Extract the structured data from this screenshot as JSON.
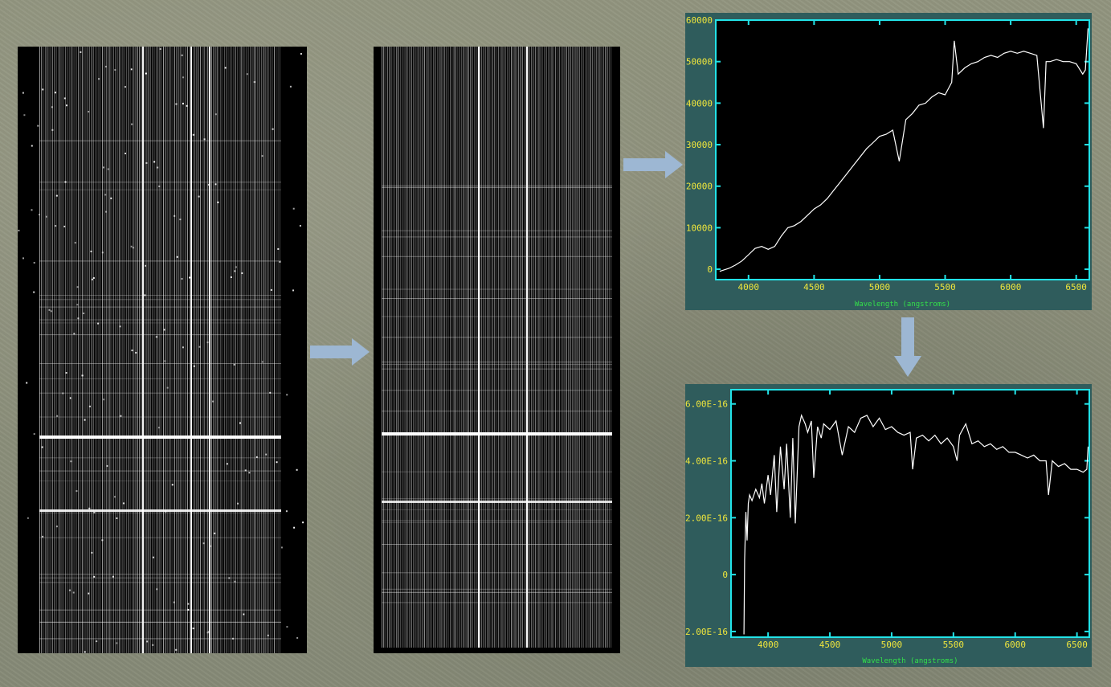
{
  "colors": {
    "background": "#8c8f7e",
    "arrow": "#9db7d3",
    "plot_panel": "#2f5c5c",
    "plot_frame": "#22e3e8",
    "tick_label": "#f0e63c",
    "axis_title": "#33e04a",
    "trace": "#ffffff"
  },
  "images": {
    "raw_frame": {
      "kind": "raw 2D spectral frame with cosmic-ray hits"
    },
    "reduced_frame": {
      "kind": "cleaned 2D spectral frame"
    }
  },
  "arrows": [
    "arrow-right",
    "arrow-right",
    "arrow-down"
  ],
  "chart_data": [
    {
      "type": "line",
      "title": "",
      "xlabel": "Wavelength (angstroms)",
      "ylabel": "",
      "xlim": [
        3750,
        6600
      ],
      "ylim": [
        -2500,
        60000
      ],
      "xticks": [
        4000,
        4500,
        5000,
        5500,
        6000,
        6500
      ],
      "xtick_labels": [
        "4000",
        "4500",
        "5000",
        "5500",
        "6000",
        "6500"
      ],
      "yticks": [
        0,
        10000,
        20000,
        30000,
        40000,
        50000,
        60000
      ],
      "ytick_labels": [
        "0",
        "10000",
        "20000",
        "30000",
        "40000",
        "50000",
        "60000"
      ],
      "series": [
        {
          "x": [
            3780,
            3850,
            3900,
            3950,
            4000,
            4050,
            4100,
            4150,
            4200,
            4250,
            4300,
            4350,
            4400,
            4450,
            4500,
            4550,
            4600,
            4650,
            4700,
            4750,
            4800,
            4850,
            4900,
            4950,
            5000,
            5050,
            5100,
            5150,
            5200,
            5250,
            5300,
            5350,
            5400,
            5450,
            5500,
            5550,
            5570,
            5600,
            5650,
            5700,
            5750,
            5800,
            5850,
            5900,
            5950,
            6000,
            6050,
            6100,
            6150,
            6200,
            6250,
            6270,
            6300,
            6350,
            6400,
            6450,
            6500,
            6550,
            6570,
            6590
          ],
          "y": [
            -500,
            200,
            1000,
            2000,
            3500,
            5000,
            5500,
            4800,
            5500,
            8000,
            10000,
            10500,
            11500,
            13000,
            14500,
            15500,
            17000,
            19000,
            21000,
            23000,
            25000,
            27000,
            29000,
            30500,
            32000,
            32500,
            33500,
            26000,
            36000,
            37500,
            39500,
            40000,
            41500,
            42500,
            42000,
            45000,
            55000,
            47000,
            48500,
            49500,
            50000,
            51000,
            51500,
            51000,
            52000,
            52500,
            52000,
            52500,
            52000,
            51500,
            34000,
            50000,
            50000,
            50500,
            50000,
            50000,
            49500,
            47000,
            48000,
            58000
          ]
        }
      ]
    },
    {
      "type": "line",
      "title": "",
      "xlabel": "Wavelength (angstroms)",
      "ylabel": "",
      "xlim": [
        3700,
        6600
      ],
      "ylim": [
        -2.2e-16,
        6.5e-16
      ],
      "xticks": [
        4000,
        4500,
        5000,
        5500,
        6000,
        6500
      ],
      "xtick_labels": [
        "4000",
        "4500",
        "5000",
        "5500",
        "6000",
        "6500"
      ],
      "yticks": [
        -2e-16,
        0,
        2e-16,
        4e-16,
        6e-16
      ],
      "ytick_labels": [
        "-2.00E-16",
        "0",
        "2.00E-16",
        "4.00E-16",
        "6.00E-16"
      ],
      "series": [
        {
          "x": [
            3805,
            3810,
            3820,
            3830,
            3840,
            3850,
            3870,
            3900,
            3930,
            3950,
            3970,
            4000,
            4020,
            4050,
            4070,
            4100,
            4130,
            4150,
            4180,
            4200,
            4220,
            4250,
            4270,
            4300,
            4320,
            4350,
            4370,
            4400,
            4430,
            4450,
            4500,
            4550,
            4600,
            4650,
            4700,
            4750,
            4800,
            4850,
            4900,
            4950,
            5000,
            5050,
            5100,
            5150,
            5170,
            5200,
            5250,
            5300,
            5350,
            5400,
            5450,
            5500,
            5530,
            5550,
            5600,
            5650,
            5700,
            5750,
            5800,
            5850,
            5900,
            5950,
            6000,
            6050,
            6100,
            6150,
            6200,
            6250,
            6270,
            6300,
            6350,
            6400,
            6450,
            6500,
            6550,
            6580,
            6590
          ],
          "y": [
            -2.1e-16,
            5e-17,
            2.2e-16,
            1.2e-16,
            2.5e-16,
            2.8e-16,
            2.6e-16,
            3e-16,
            2.7e-16,
            3.2e-16,
            2.5e-16,
            3.5e-16,
            2.8e-16,
            4.2e-16,
            2.2e-16,
            4.5e-16,
            3e-16,
            4.6e-16,
            2e-16,
            4.8e-16,
            1.8e-16,
            5.2e-16,
            5.6e-16,
            5.3e-16,
            5e-16,
            5.4e-16,
            3.4e-16,
            5.2e-16,
            4.8e-16,
            5.3e-16,
            5.1e-16,
            5.4e-16,
            4.2e-16,
            5.2e-16,
            5e-16,
            5.5e-16,
            5.6e-16,
            5.2e-16,
            5.5e-16,
            5.1e-16,
            5.2e-16,
            5e-16,
            4.9e-16,
            5e-16,
            3.7e-16,
            4.8e-16,
            4.9e-16,
            4.7e-16,
            4.9e-16,
            4.6e-16,
            4.8e-16,
            4.5e-16,
            4e-16,
            4.9e-16,
            5.3e-16,
            4.6e-16,
            4.7e-16,
            4.5e-16,
            4.6e-16,
            4.4e-16,
            4.5e-16,
            4.3e-16,
            4.3e-16,
            4.2e-16,
            4.1e-16,
            4.2e-16,
            4e-16,
            4e-16,
            2.8e-16,
            4e-16,
            3.8e-16,
            3.9e-16,
            3.7e-16,
            3.7e-16,
            3.6e-16,
            3.7e-16,
            4.5e-16
          ]
        }
      ]
    }
  ]
}
